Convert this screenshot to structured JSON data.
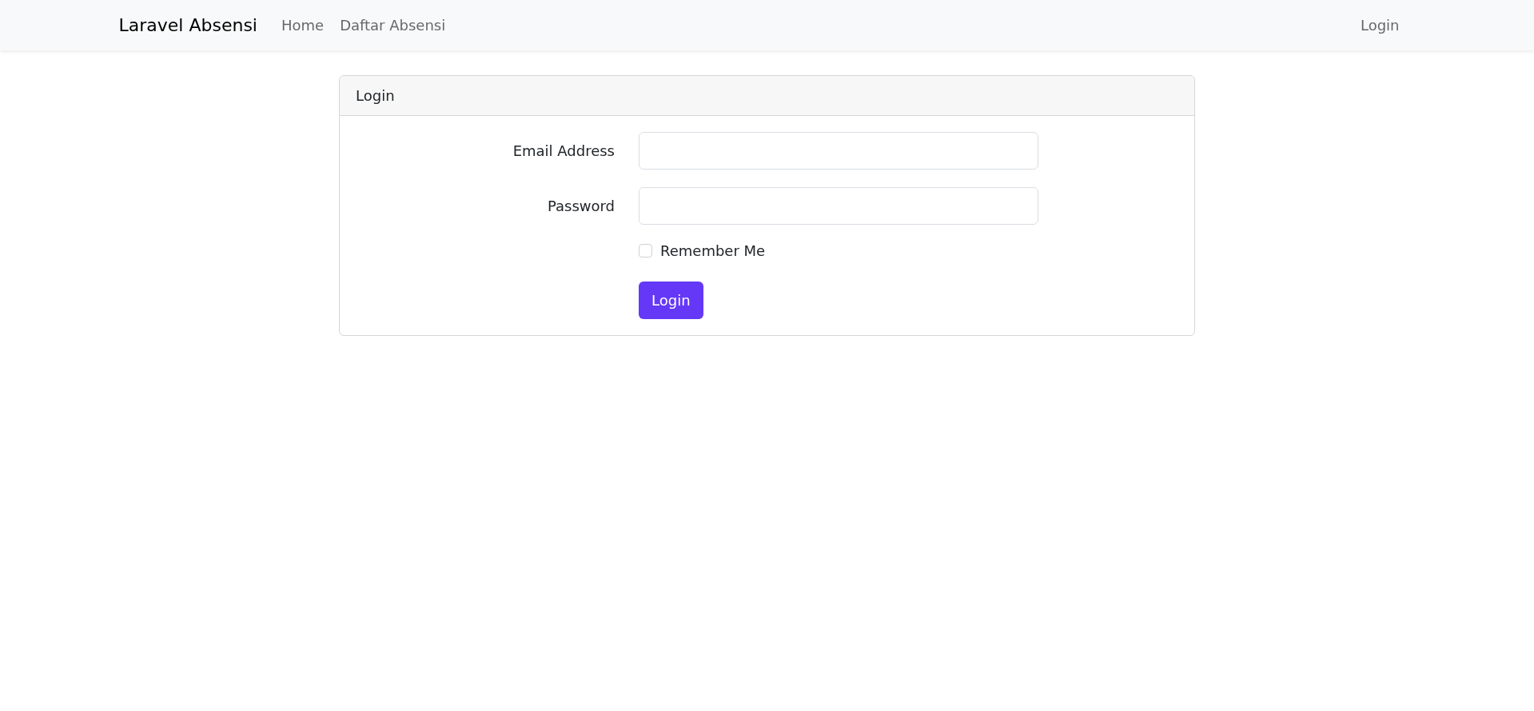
{
  "navbar": {
    "brand": "Laravel Absensi",
    "links": [
      {
        "label": "Home"
      },
      {
        "label": "Daftar Absensi"
      }
    ],
    "right_links": [
      {
        "label": "Login"
      }
    ]
  },
  "card": {
    "title": "Login",
    "fields": [
      {
        "label": "Email Address"
      },
      {
        "label": "Password"
      }
    ],
    "remember": {
      "label": "Remember Me",
      "checked": false
    },
    "button": "Login"
  }
}
